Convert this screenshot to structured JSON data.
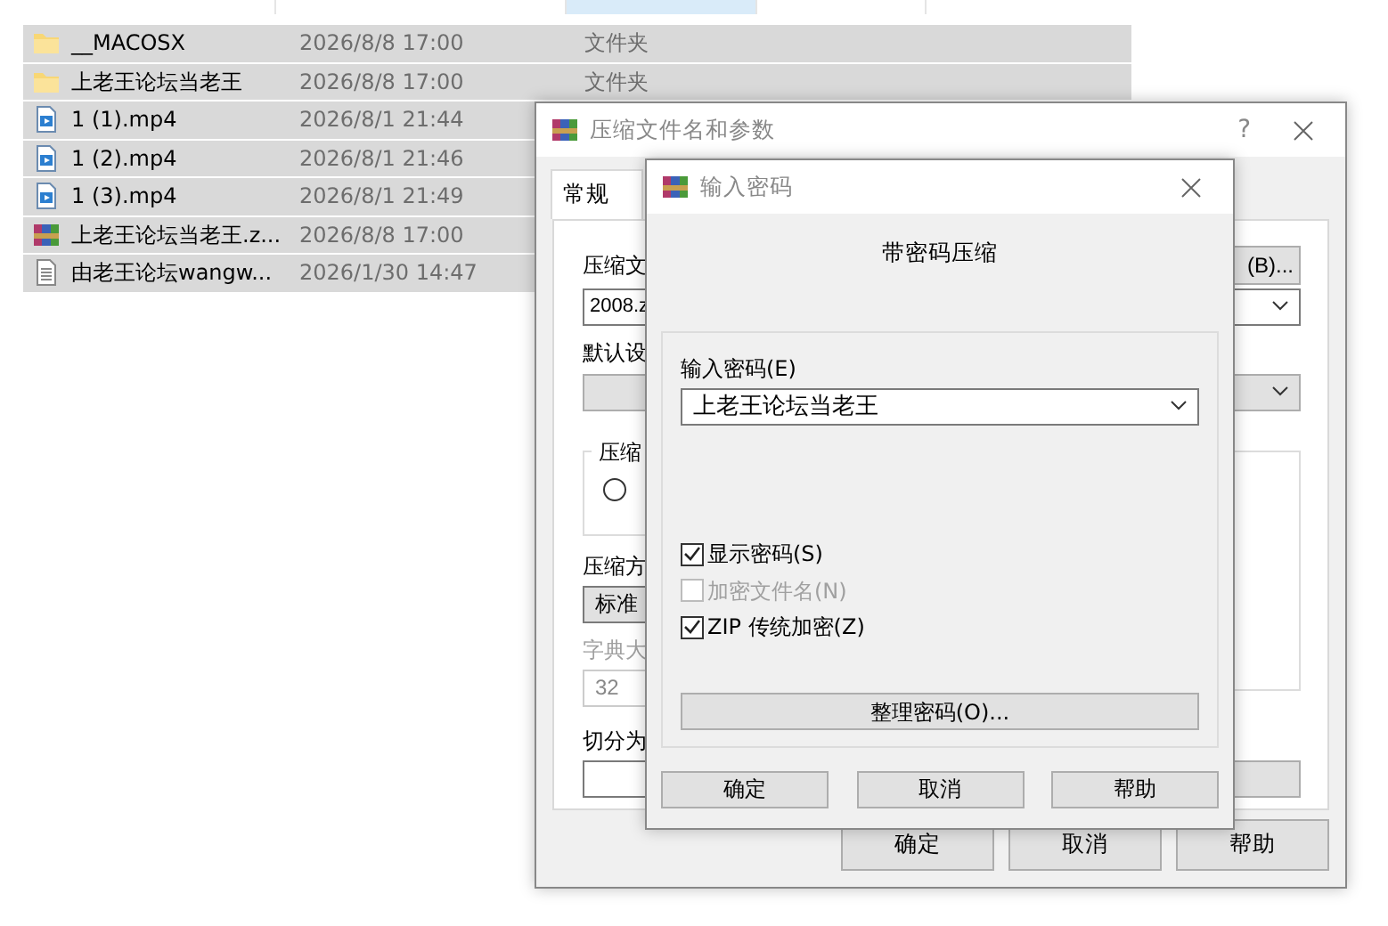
{
  "file_list": {
    "rows": [
      {
        "kind": "folder",
        "name": "__MACOSX",
        "modified": "2026/8/8 17:00",
        "type": "文件夹",
        "selected": true
      },
      {
        "kind": "folder",
        "name": "上老王论坛当老王",
        "modified": "2026/8/8 17:00",
        "type": "文件夹",
        "selected": true
      },
      {
        "kind": "video",
        "name": "1 (1).mp4",
        "modified": "2026/8/1 21:44",
        "selected": true
      },
      {
        "kind": "video",
        "name": "1 (2).mp4",
        "modified": "2026/8/1 21:46",
        "selected": true
      },
      {
        "kind": "video",
        "name": "1 (3).mp4",
        "modified": "2026/8/1 21:49",
        "selected": true
      },
      {
        "kind": "archive",
        "name": "上老王论坛当老王.z...",
        "modified": "2026/8/8 17:00",
        "selected": true
      },
      {
        "kind": "text",
        "name": "由老王论坛wangw...",
        "modified": "2026/1/30 14:47",
        "selected": true
      }
    ]
  },
  "compress_dialog": {
    "title": "压缩文件名和参数",
    "help": "?",
    "tabs": [
      {
        "label": "常规",
        "selected": true
      }
    ],
    "archive_name_label": "压缩文",
    "browse_button": "(B)...",
    "archive_name_value": "2008.z",
    "profile_label": "默认设",
    "format_group": "压缩",
    "format_radio": {
      "selected": false
    },
    "method_label": "压缩方",
    "method_value": "标准",
    "dictionary_label": "字典大",
    "dictionary_value": "32",
    "split_label": "切分为",
    "buttons": [
      "确定",
      "取消",
      "帮助"
    ]
  },
  "password_dialog": {
    "title": "输入密码",
    "heading": "带密码压缩",
    "password_label": "输入密码(E)",
    "password_value": "上老王论坛当老王",
    "options": [
      {
        "label": "显示密码(S)",
        "checked": true,
        "disabled": false
      },
      {
        "label": "加密文件名(N)",
        "checked": false,
        "disabled": true
      },
      {
        "label": "ZIP 传统加密(Z)",
        "checked": true,
        "disabled": false
      }
    ],
    "organize_button": "整理密码(O)...",
    "buttons": [
      "确定",
      "取消",
      "帮助"
    ]
  }
}
